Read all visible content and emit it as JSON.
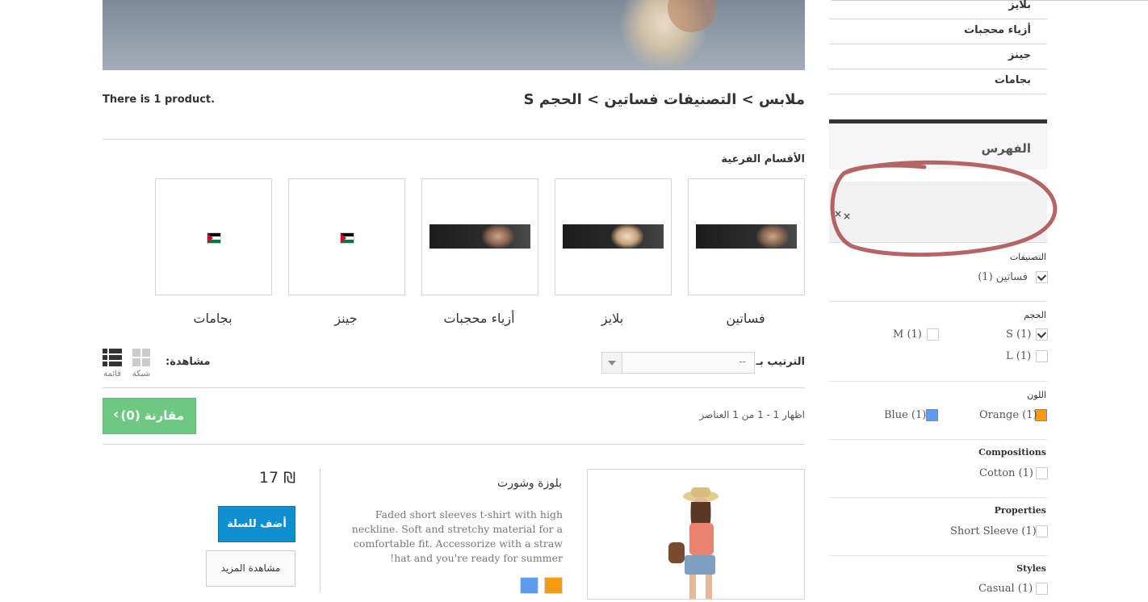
{
  "breadcrumb": "ملابس > التصنيفات فساتين > الحجم S",
  "product_count": "There is 1 product.",
  "subcategories": {
    "heading": "الأقسام الفرعية",
    "items": [
      {
        "label": "فساتين"
      },
      {
        "label": "بلايز"
      },
      {
        "label": "أزياء محجبات"
      },
      {
        "label": "جينز"
      },
      {
        "label": "بجامات"
      }
    ]
  },
  "sort": {
    "label": "الترتيب بـ",
    "value": "--"
  },
  "view": {
    "label": "مشاهدة:",
    "grid": "شبكة",
    "list": "قائمة"
  },
  "showing": "اظهار 1 - 1 من 1 العناصر",
  "compare": {
    "label": "مقارنة (0)"
  },
  "product": {
    "name": "بلوزة وشورت",
    "description": "Faded short sleeves t-shirt with high neckline. Soft and stretchy material for a comfortable fit. Accessorize with a straw hat and you're ready for summer!",
    "price": "17 ₪",
    "add_to_cart": "أضف للسلة",
    "more": "مشاهدة المزيد",
    "colors": [
      "#f39c11",
      "#5d9cec"
    ]
  },
  "sidebar": {
    "categories": [
      {
        "label": "بلايز"
      },
      {
        "label": "أزياء محجبات"
      },
      {
        "label": "جينز"
      },
      {
        "label": "بجامات"
      }
    ],
    "filter_title": "الفهرس",
    "filters": {
      "categories": {
        "label": "التصنيفات",
        "options": [
          {
            "label": "فساتين (1)",
            "checked": true
          }
        ]
      },
      "size": {
        "label": "الحجم",
        "options": [
          {
            "label": "S (1)",
            "checked": true
          },
          {
            "label": "M (1)",
            "checked": false
          },
          {
            "label": "L (1)",
            "checked": false
          }
        ]
      },
      "color": {
        "label": "اللون",
        "options": [
          {
            "label": "Orange (1)",
            "color": "#f39c11"
          },
          {
            "label": "Blue (1)",
            "color": "#5d9cec"
          }
        ]
      },
      "compositions": {
        "label": "Compositions",
        "options": [
          {
            "label": "Cotton (1)",
            "checked": false
          }
        ]
      },
      "properties": {
        "label": "Properties",
        "options": [
          {
            "label": "Short Sleeve (1)",
            "checked": false
          }
        ]
      },
      "styles": {
        "label": "Styles",
        "options": [
          {
            "label": "Casual (1)",
            "checked": false
          }
        ]
      }
    }
  }
}
